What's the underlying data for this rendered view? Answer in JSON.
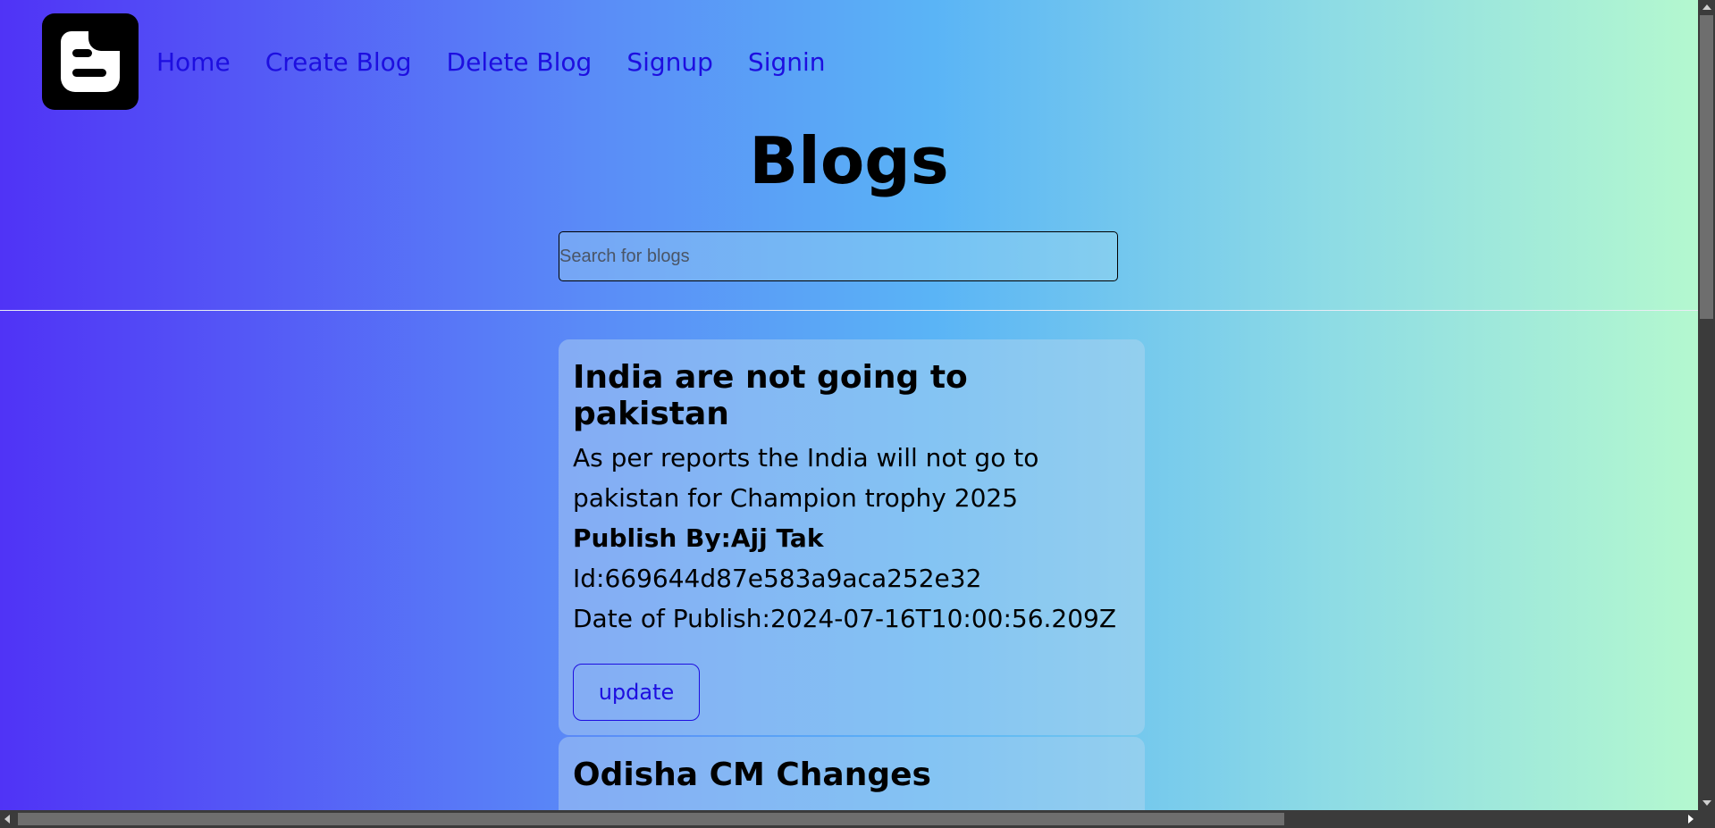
{
  "nav": {
    "logo_icon": "blogger-icon",
    "links": [
      "Home",
      "Create Blog",
      "Delete Blog",
      "Signup",
      "Signin"
    ]
  },
  "page": {
    "title": "Blogs"
  },
  "search": {
    "placeholder": "Search for blogs",
    "value": ""
  },
  "blogs": [
    {
      "title": "India are not going to pakistan",
      "body": "As per reports the India will not go to pakistan for Champion trophy 2025",
      "author": "Publish By:Ajj Tak",
      "id": "Id:669644d87e583a9aca252e32",
      "date": "Date of Publish:2024-07-16T10:00:56.209Z",
      "update_label": "update"
    },
    {
      "title": "Odisha CM Changes"
    }
  ],
  "colors": {
    "link": "#1d0ee0",
    "gradient_start": "#5033f6",
    "gradient_end": "#b4f8cf"
  }
}
